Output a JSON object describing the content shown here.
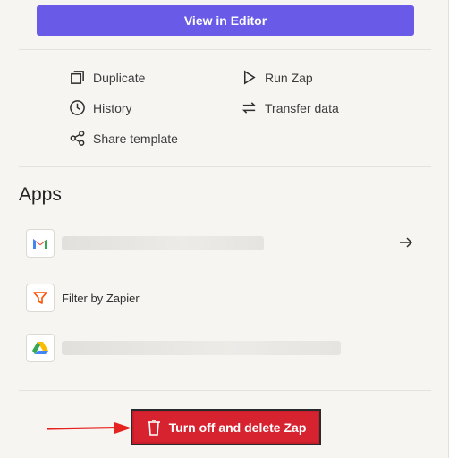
{
  "header": {
    "view_editor_label": "View in Editor"
  },
  "actions": {
    "duplicate": "Duplicate",
    "run_zap": "Run Zap",
    "history": "History",
    "transfer_data": "Transfer data",
    "share_template": "Share template"
  },
  "apps": {
    "heading": "Apps",
    "items": [
      {
        "icon": "gmail-icon",
        "label": ""
      },
      {
        "icon": "filter-icon",
        "label": "Filter by Zapier"
      },
      {
        "icon": "google-drive-icon",
        "label": ""
      }
    ]
  },
  "footer": {
    "delete_label": "Turn off and delete Zap"
  },
  "colors": {
    "accent": "#695be8",
    "danger": "#d6232f",
    "background": "#f7f5f2"
  }
}
